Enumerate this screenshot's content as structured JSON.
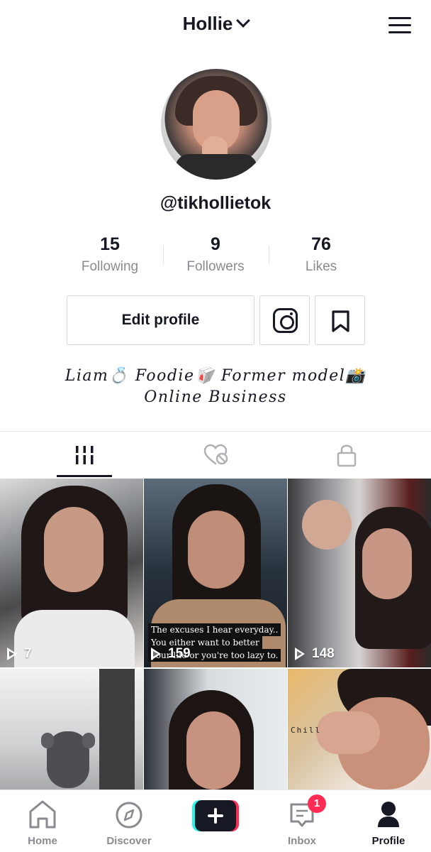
{
  "header": {
    "account_name": "Hollie",
    "account_switch_icon": "chevron-down-icon",
    "menu_icon": "hamburger-menu-icon"
  },
  "profile": {
    "handle": "@tikhollietok",
    "stats": [
      {
        "value": "15",
        "label": "Following"
      },
      {
        "value": "9",
        "label": "Followers"
      },
      {
        "value": "76",
        "label": "Likes"
      }
    ],
    "edit_profile_label": "Edit profile",
    "instagram_icon": "instagram-icon",
    "bookmark_icon": "bookmark-icon",
    "bio_line1": "Liam💍 Foodie🥡 Former model📸",
    "bio_line2": "Online Business"
  },
  "tabs": [
    {
      "icon": "grid-videos-icon",
      "active": true
    },
    {
      "icon": "liked-videos-hidden-icon",
      "active": false
    },
    {
      "icon": "lock-icon",
      "active": false
    }
  ],
  "videos": [
    {
      "views": "7"
    },
    {
      "views": "159",
      "caption_line1": "The excuses I hear everyday..",
      "caption_line2": "You either want to better",
      "caption_line3": "your life or you're too lazy to."
    },
    {
      "views": "148"
    },
    {
      "views": ""
    },
    {
      "views": ""
    },
    {
      "views": "",
      "overlay_text": "Chill"
    }
  ],
  "bottom_nav": {
    "items": [
      {
        "label": "Home",
        "icon": "home-icon"
      },
      {
        "label": "Discover",
        "icon": "compass-icon"
      },
      {
        "label": "",
        "icon": "create-plus-icon"
      },
      {
        "label": "Inbox",
        "icon": "inbox-icon",
        "badge": "1"
      },
      {
        "label": "Profile",
        "icon": "profile-icon",
        "active": true
      }
    ]
  },
  "colors": {
    "text_primary": "#161823",
    "text_secondary": "#8a8b91",
    "accent_red": "#fe2c55",
    "accent_cyan": "#25f4ee",
    "divider": "#e3e3e4"
  }
}
